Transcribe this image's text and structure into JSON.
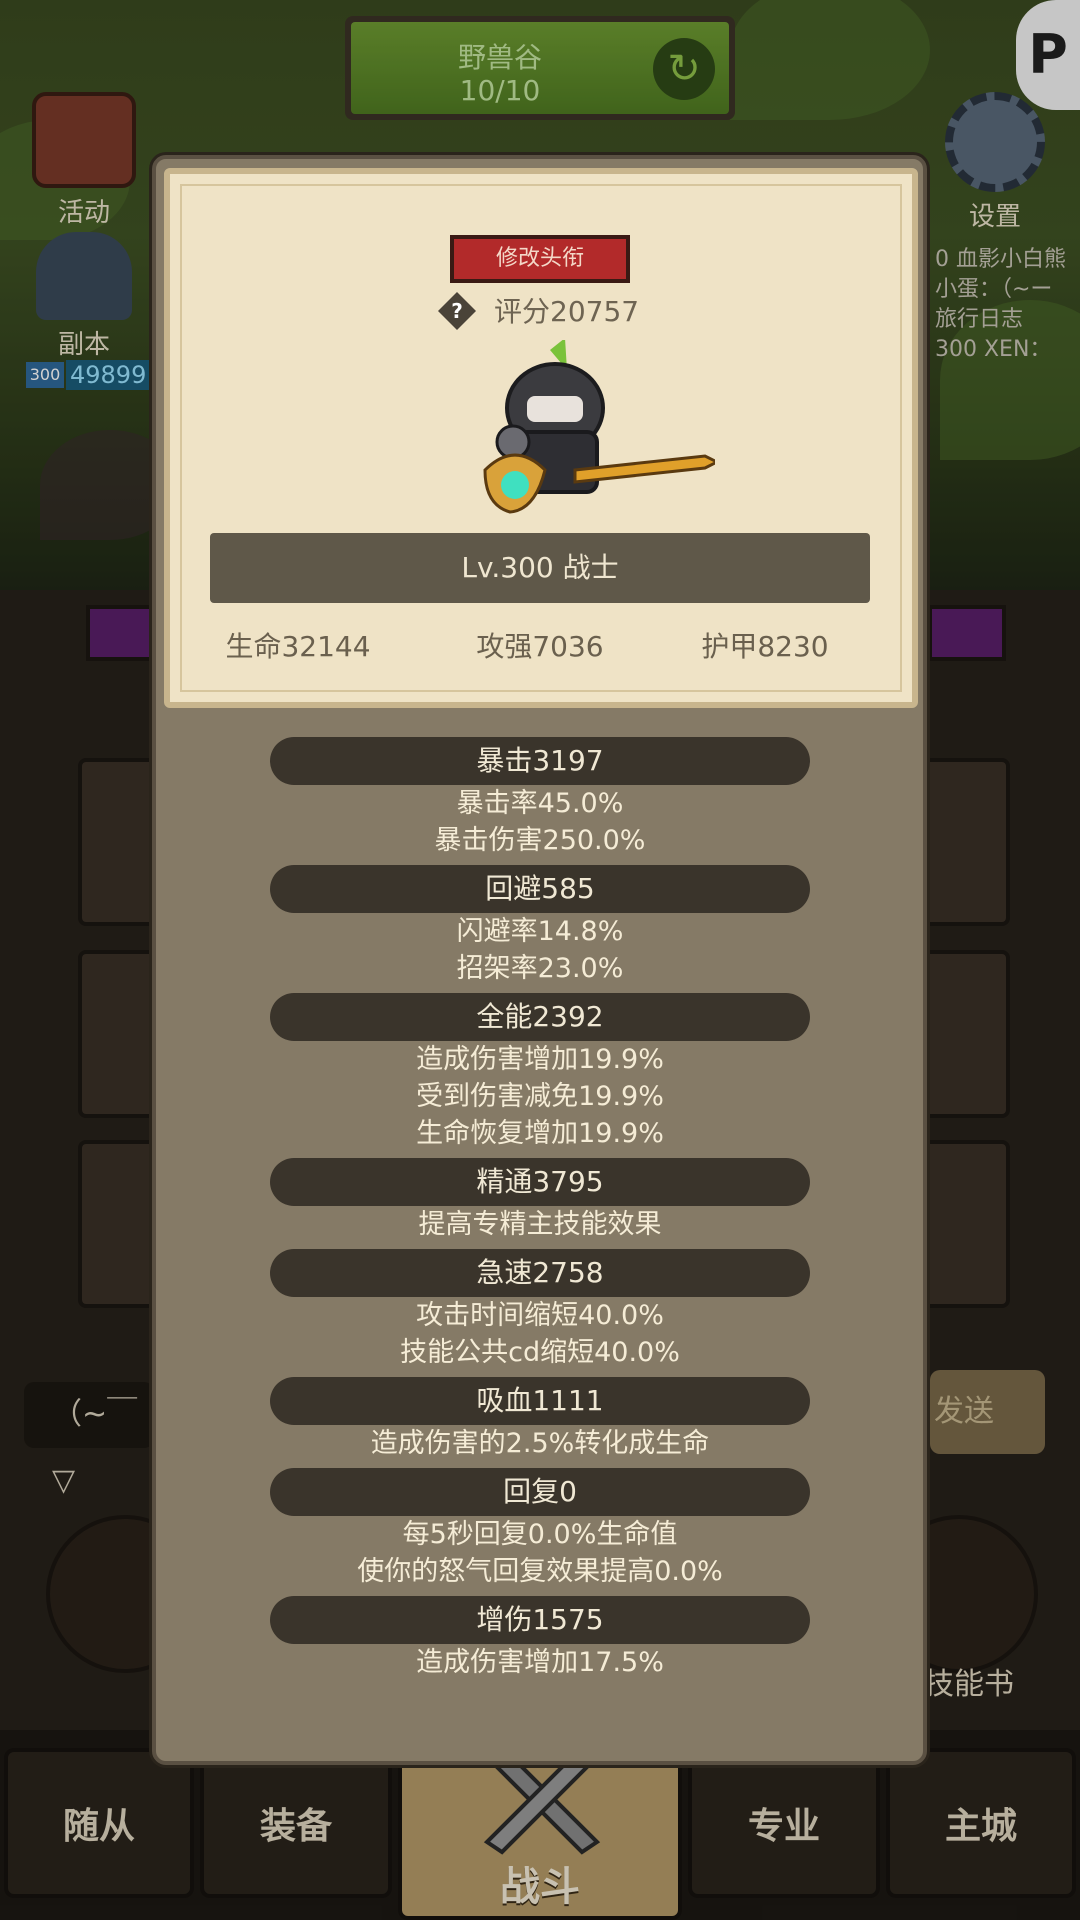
{
  "top": {
    "zone_name": "野兽谷",
    "zone_count": "10/10",
    "activity_label": "活动",
    "settings_label": "设置",
    "dungeon_label": "副本",
    "player_level": "300",
    "player_power": "49899",
    "right_names": [
      "0 血影小白熊",
      "小蛋：（~ー",
      "旅行日志",
      "300 XEN："
    ]
  },
  "chat": {
    "input_text": "（~￣▽",
    "send_label": "发送"
  },
  "round_buttons": {
    "skill_book_label": "技能书"
  },
  "bottom_nav": {
    "tabs": [
      "随从",
      "装备",
      "战斗",
      "专业",
      "主城"
    ]
  },
  "modal": {
    "rename_button": "修改头衔",
    "score_label": "评分20757",
    "level_class": "Lv.300 战士",
    "base_stats": [
      "生命32144",
      "攻强7036",
      "护甲8230"
    ],
    "stat_groups": [
      {
        "header": "暴击3197",
        "lines": [
          "暴击率45.0%",
          "暴击伤害250.0%"
        ]
      },
      {
        "header": "回避585",
        "lines": [
          "闪避率14.8%",
          "招架率23.0%"
        ]
      },
      {
        "header": "全能2392",
        "lines": [
          "造成伤害增加19.9%",
          "受到伤害减免19.9%",
          "生命恢复增加19.9%"
        ]
      },
      {
        "header": "精通3795",
        "lines": [
          "提高专精主技能效果"
        ]
      },
      {
        "header": "急速2758",
        "lines": [
          "攻击时间缩短40.0%",
          "技能公共cd缩短40.0%"
        ]
      },
      {
        "header": "吸血1111",
        "lines": [
          "造成伤害的2.5%转化成生命"
        ]
      },
      {
        "header": "回复0",
        "lines": [
          "每5秒回复0.0%生命值",
          "使你的怒气回复效果提高0.0%"
        ]
      },
      {
        "header": "增伤1575",
        "lines": [
          "造成伤害增加17.5%"
        ]
      }
    ]
  },
  "colors": {
    "rename_red": "#b22a2a",
    "parchment": "#efe3c6",
    "modal_panel": "#857a66",
    "stat_band": "#3a342b"
  },
  "icons": [
    "refresh-icon",
    "activity-book-icon",
    "gear-icon",
    "dungeon-icon",
    "help-icon",
    "p-logo-icon",
    "crossed-swords-icon"
  ]
}
